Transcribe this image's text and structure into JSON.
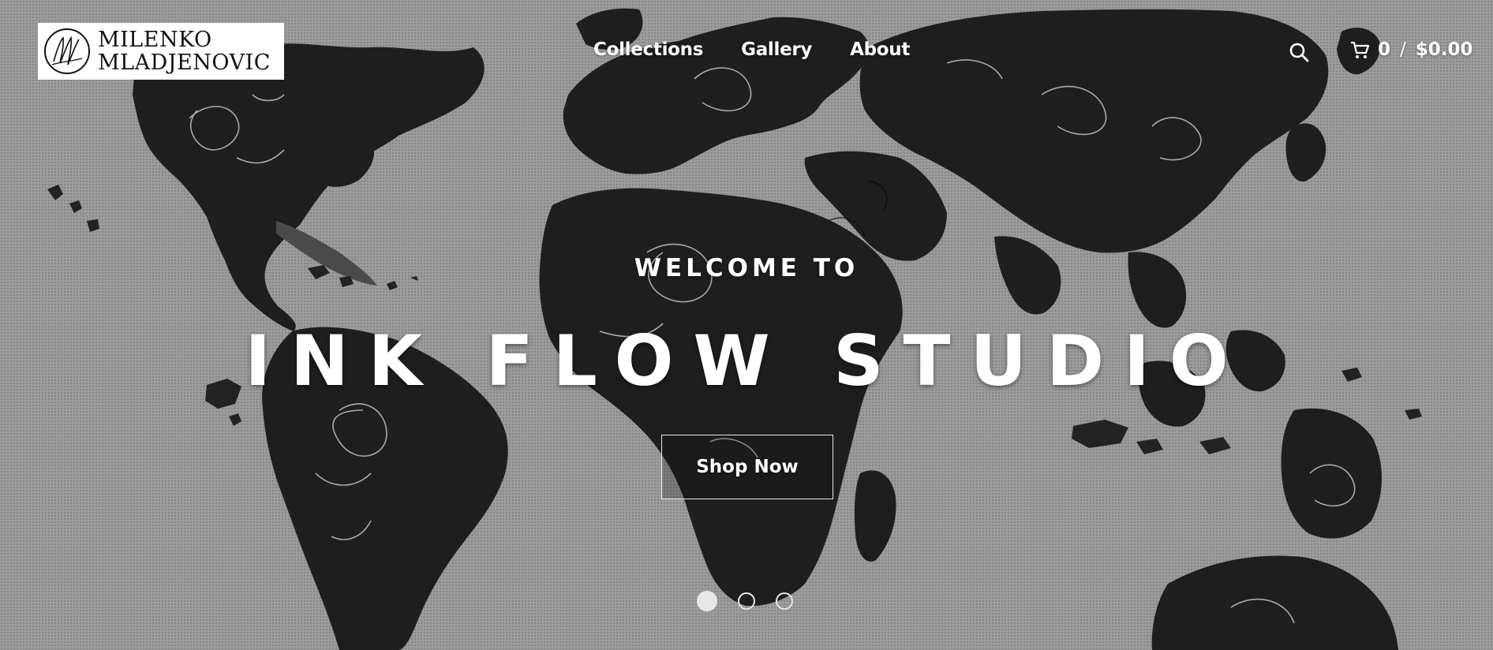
{
  "header": {
    "logo": {
      "line1": "MILENKO",
      "line2": "MLADJENOVIC",
      "icon": "signature-monogram-icon"
    },
    "nav": [
      {
        "label": "Collections"
      },
      {
        "label": "Gallery"
      },
      {
        "label": "About"
      }
    ],
    "search_icon": "search-icon",
    "cart": {
      "icon": "cart-icon",
      "count": "0",
      "separator": "/",
      "total": "$0.00"
    }
  },
  "hero": {
    "subtitle": "WELCOME TO",
    "title": "INK FLOW STUDIO",
    "button_label": "Shop Now",
    "background": "black-and-white illustrated world map",
    "slides_total": 3,
    "slides_active": 1
  },
  "colors": {
    "text": "#ffffff",
    "background": "#9c9c9c",
    "land": "#1e1e1e"
  }
}
